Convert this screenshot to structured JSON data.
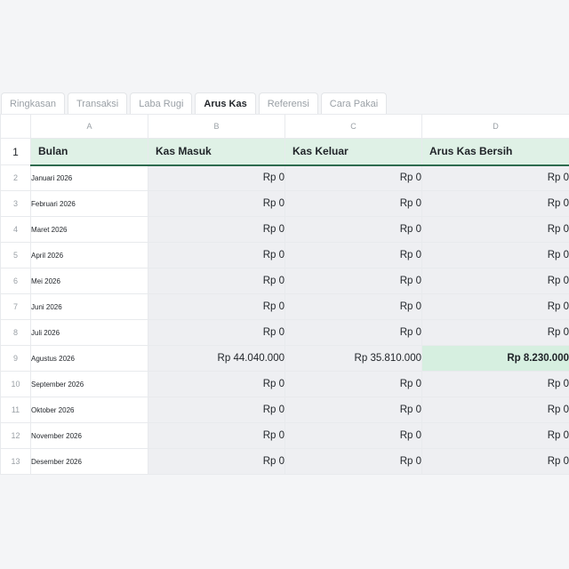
{
  "tabs": [
    {
      "label": "Ringkasan",
      "active": false
    },
    {
      "label": "Transaksi",
      "active": false
    },
    {
      "label": "Laba Rugi",
      "active": false
    },
    {
      "label": "Arus Kas",
      "active": true
    },
    {
      "label": "Referensi",
      "active": false
    },
    {
      "label": "Cara Pakai",
      "active": false
    }
  ],
  "columns": [
    "A",
    "B",
    "C",
    "D"
  ],
  "header_row": {
    "row_num": "1",
    "cells": [
      "Bulan",
      "Kas Masuk",
      "Kas Keluar",
      "Arus Kas Bersih"
    ]
  },
  "rows": [
    {
      "row_num": "2",
      "month": "Januari 2026",
      "kas_masuk": "Rp 0",
      "kas_keluar": "Rp 0",
      "arus_kas_bersih": "Rp 0"
    },
    {
      "row_num": "3",
      "month": "Februari 2026",
      "kas_masuk": "Rp 0",
      "kas_keluar": "Rp 0",
      "arus_kas_bersih": "Rp 0"
    },
    {
      "row_num": "4",
      "month": "Maret 2026",
      "kas_masuk": "Rp 0",
      "kas_keluar": "Rp 0",
      "arus_kas_bersih": "Rp 0"
    },
    {
      "row_num": "5",
      "month": "April 2026",
      "kas_masuk": "Rp 0",
      "kas_keluar": "Rp 0",
      "arus_kas_bersih": "Rp 0"
    },
    {
      "row_num": "6",
      "month": "Mei 2026",
      "kas_masuk": "Rp 0",
      "kas_keluar": "Rp 0",
      "arus_kas_bersih": "Rp 0"
    },
    {
      "row_num": "7",
      "month": "Juni 2026",
      "kas_masuk": "Rp 0",
      "kas_keluar": "Rp 0",
      "arus_kas_bersih": "Rp 0"
    },
    {
      "row_num": "8",
      "month": "Juli 2026",
      "kas_masuk": "Rp 0",
      "kas_keluar": "Rp 0",
      "arus_kas_bersih": "Rp 0"
    },
    {
      "row_num": "9",
      "month": "Agustus 2026",
      "kas_masuk": "Rp 44.040.000",
      "kas_keluar": "Rp 35.810.000",
      "arus_kas_bersih": "Rp 8.230.000",
      "highlight": true
    },
    {
      "row_num": "10",
      "month": "September 2026",
      "kas_masuk": "Rp 0",
      "kas_keluar": "Rp 0",
      "arus_kas_bersih": "Rp 0"
    },
    {
      "row_num": "11",
      "month": "Oktober 2026",
      "kas_masuk": "Rp 0",
      "kas_keluar": "Rp 0",
      "arus_kas_bersih": "Rp 0"
    },
    {
      "row_num": "12",
      "month": "November 2026",
      "kas_masuk": "Rp 0",
      "kas_keluar": "Rp 0",
      "arus_kas_bersih": "Rp 0"
    },
    {
      "row_num": "13",
      "month": "Desember 2026",
      "kas_masuk": "Rp 0",
      "kas_keluar": "Rp 0",
      "arus_kas_bersih": "Rp 0"
    }
  ],
  "colors": {
    "header_fill": "#dff1e6",
    "header_underline": "#2e6b4f",
    "value_fill": "#eeeff2",
    "highlight_fill": "#d6efe0"
  }
}
